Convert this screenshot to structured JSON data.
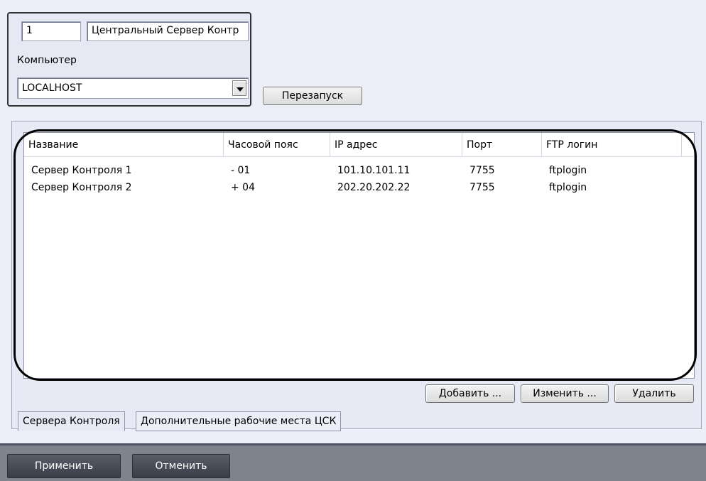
{
  "object": {
    "id": "1",
    "name": "Центральный Сервер Контр",
    "computer_label": "Компьютер",
    "computer_value": "LOCALHOST"
  },
  "restart_label": "Перезапуск",
  "table": {
    "columns": [
      "Название",
      "Часовой пояс",
      "IP адрес",
      "Порт",
      "FTP логин"
    ],
    "rows": [
      [
        "Сервер Контроля 1",
        "- 01",
        "101.10.101.11",
        "7755",
        "ftplogin"
      ],
      [
        "Сервер Контроля 2",
        "+ 04",
        "202.20.202.22",
        "7755",
        "ftplogin"
      ]
    ]
  },
  "buttons": {
    "add": "Добавить ...",
    "edit": "Изменить ...",
    "delete": "Удалить"
  },
  "tabs": [
    {
      "label": "Сервера Контроля",
      "active": true
    },
    {
      "label": "Дополнительные рабочие места ЦСК",
      "active": false
    }
  ],
  "footer": {
    "apply": "Применить",
    "cancel": "Отменить"
  },
  "colors": {
    "background": "#eceff8",
    "footer": "#7f838c",
    "highlight": "#000000"
  }
}
